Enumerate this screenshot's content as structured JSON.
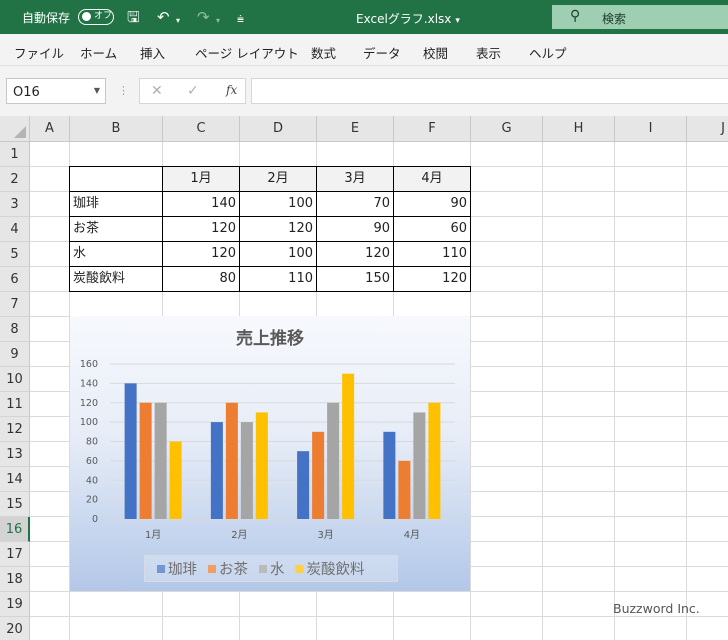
{
  "titlebar": {
    "autosave_label": "自動保存",
    "autosave_state": "オフ",
    "filename": "Excelグラフ.xlsx",
    "search_placeholder": "検索",
    "color": "#217346"
  },
  "menu": [
    "ファイル",
    "ホーム",
    "挿入",
    "ページ レイアウト",
    "数式",
    "データ",
    "校閲",
    "表示",
    "ヘルプ"
  ],
  "formula_bar": {
    "name_box": "O16",
    "formula": ""
  },
  "grid": {
    "columns": [
      "A",
      "B",
      "C",
      "D",
      "E",
      "F",
      "G",
      "H",
      "I",
      "J"
    ],
    "rows": [
      "1",
      "2",
      "3",
      "4",
      "5",
      "6",
      "7",
      "8",
      "9",
      "10",
      "11",
      "12",
      "13",
      "14",
      "15",
      "16",
      "17",
      "18",
      "19",
      "20"
    ],
    "active_row": "16"
  },
  "table": {
    "headers": [
      "",
      "1月",
      "2月",
      "3月",
      "4月"
    ],
    "rows": [
      [
        "珈琲",
        "140",
        "100",
        "70",
        "90"
      ],
      [
        "お茶",
        "120",
        "120",
        "90",
        "60"
      ],
      [
        "水",
        "120",
        "100",
        "120",
        "110"
      ],
      [
        "炭酸飲料",
        "80",
        "110",
        "150",
        "120"
      ]
    ]
  },
  "chart_data": {
    "type": "bar",
    "title": "売上推移",
    "categories": [
      "1月",
      "2月",
      "3月",
      "4月"
    ],
    "series": [
      {
        "name": "珈琲",
        "values": [
          140,
          100,
          70,
          90
        ],
        "color": "#4472c4"
      },
      {
        "name": "お茶",
        "values": [
          120,
          120,
          90,
          60
        ],
        "color": "#ed7d31"
      },
      {
        "name": "水",
        "values": [
          120,
          100,
          120,
          110
        ],
        "color": "#a5a5a5"
      },
      {
        "name": "炭酸飲料",
        "values": [
          80,
          110,
          150,
          120
        ],
        "color": "#ffc000"
      }
    ],
    "ylim": [
      0,
      160
    ],
    "yticks": [
      "0",
      "20",
      "40",
      "60",
      "80",
      "100",
      "120",
      "140",
      "160"
    ],
    "grid": true,
    "legend": "bottom"
  },
  "watermark": "Buzzword Inc."
}
